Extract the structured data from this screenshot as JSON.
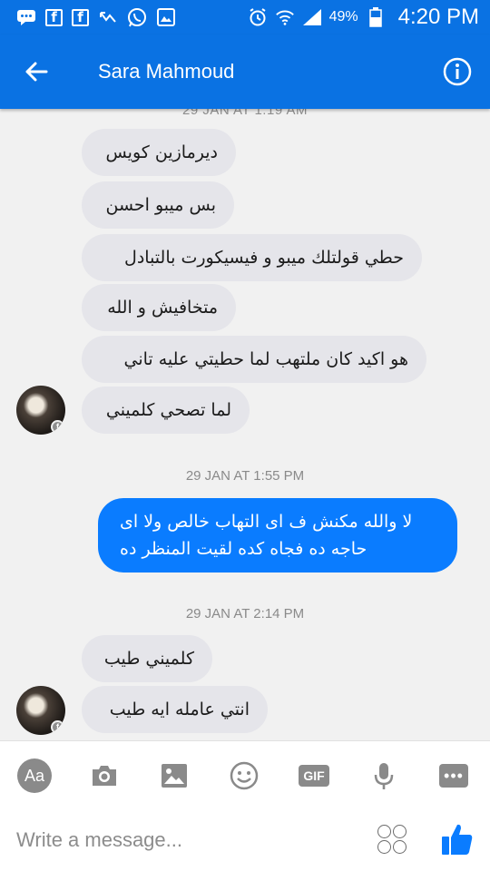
{
  "status_bar": {
    "battery": "49%",
    "time": "4:20 PM"
  },
  "header": {
    "contact_name": "Sara Mahmoud"
  },
  "chat": {
    "cut_timestamp": "29 JAN AT 1:19 AM",
    "messages_group1": [
      "ديرمازين كويس",
      "بس ميبو احسن",
      "حطي قولتلك ميبو و فيسيكورت بالتبادل",
      "متخافيش و الله",
      "هو اكيد كان ملتهب لما حطيتي عليه تاني",
      "لما تصحي كلميني"
    ],
    "timestamp2": "29 JAN AT 1:55 PM",
    "outgoing": {
      "line1": "لا والله مكنش ف اى التهاب خالص ولا اى",
      "line2": "حاجه ده فجاه كده لقيت المنظر ده"
    },
    "timestamp3": "29 JAN AT 2:14 PM",
    "messages_group2": [
      "كلميني طيب",
      "انتي عامله ايه طيب"
    ]
  },
  "composer": {
    "aa_label": "Aa",
    "gif_label": "GIF",
    "placeholder": "Write a message..."
  },
  "colors": {
    "brand_blue": "#0a72e3",
    "outgoing_bubble": "#0a7cff",
    "incoming_bubble": "#e5e5ea"
  }
}
